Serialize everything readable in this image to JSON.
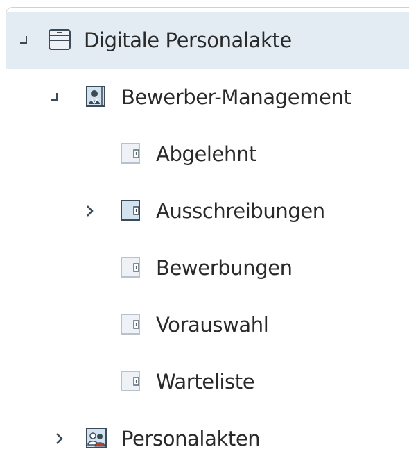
{
  "tree": {
    "root": {
      "label": "Digitale Personalakte",
      "toggle_icon": "collapse-icon",
      "icon": "cabinet-icon",
      "selected": true
    },
    "bewerber": {
      "label": "Bewerber-Management",
      "toggle_icon": "collapse-icon",
      "icon": "person-folder-icon"
    },
    "abgelehnt": {
      "label": "Abgelehnt",
      "icon": "register-icon"
    },
    "ausschreibungen": {
      "label": "Ausschreibungen",
      "toggle_icon": "chevron-right-icon",
      "icon": "register-icon"
    },
    "bewerbungen": {
      "label": "Bewerbungen",
      "icon": "register-icon"
    },
    "vorauswahl": {
      "label": "Vorauswahl",
      "icon": "register-icon"
    },
    "warteliste": {
      "label": "Warteliste",
      "icon": "register-icon"
    },
    "personalakten": {
      "label": "Personalakten",
      "toggle_icon": "chevron-right-icon",
      "icon": "people-folder-icon"
    }
  },
  "colors": {
    "selection": "#e3ecf3",
    "border": "#c9d3dd",
    "icon_outline": "#3c4b5a",
    "icon_fill_light": "#eef1f5",
    "icon_fill_blue": "#d2e2ef"
  }
}
